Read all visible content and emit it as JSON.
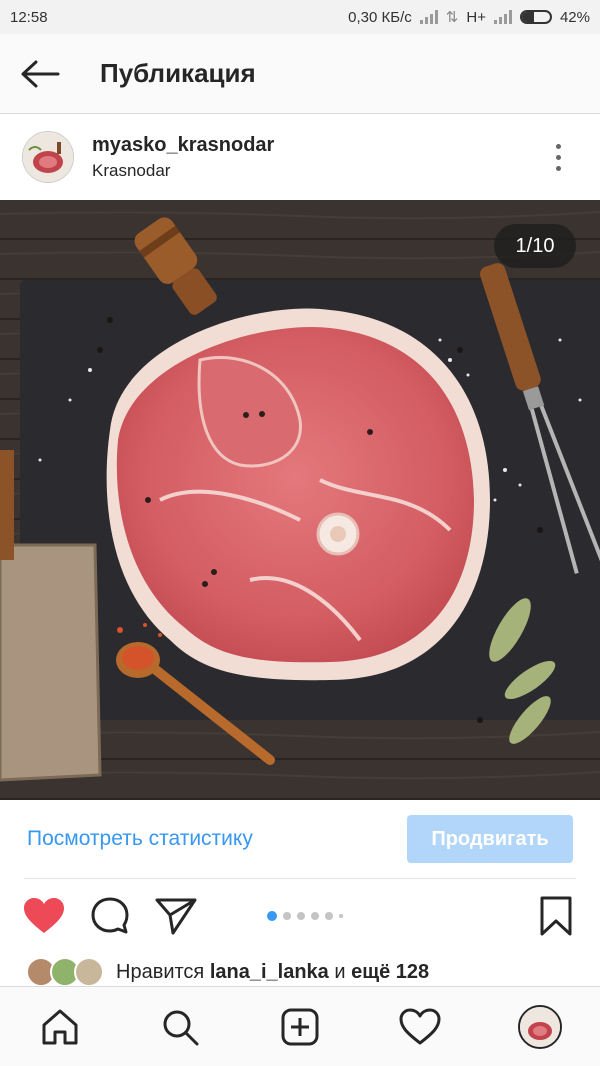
{
  "status_bar": {
    "time": "12:58",
    "network_speed": "0,30 КБ/с",
    "network_type": "H+",
    "battery": "42%",
    "battery_level": 0.42
  },
  "app_bar": {
    "back_icon": "arrow-left-icon",
    "title": "Публикация"
  },
  "post": {
    "username": "myasko_krasnodar",
    "location": "Krasnodar",
    "photo_counter": "1/10",
    "photo_alt": "raw pork ham steak on slate board",
    "carousel_total_dots": 6,
    "carousel_active_index": 0
  },
  "stats": {
    "link_label": "Посмотреть статистику",
    "promote_label": "Продвигать"
  },
  "actions": {
    "like_icon": "heart-filled-icon",
    "comment_icon": "comment-icon",
    "share_icon": "paper-plane-icon",
    "save_icon": "bookmark-icon"
  },
  "likes": {
    "prefix": "Нравится",
    "user": "lana_i_lanka",
    "connector": "и",
    "others": "ещё 128"
  },
  "bottom_nav": [
    "home-icon",
    "search-icon",
    "add-post-icon",
    "heart-icon",
    "profile-avatar"
  ],
  "colors": {
    "accent": "#3897f0",
    "like": "#ed4956",
    "promote_bg": "#b2d6f9"
  }
}
